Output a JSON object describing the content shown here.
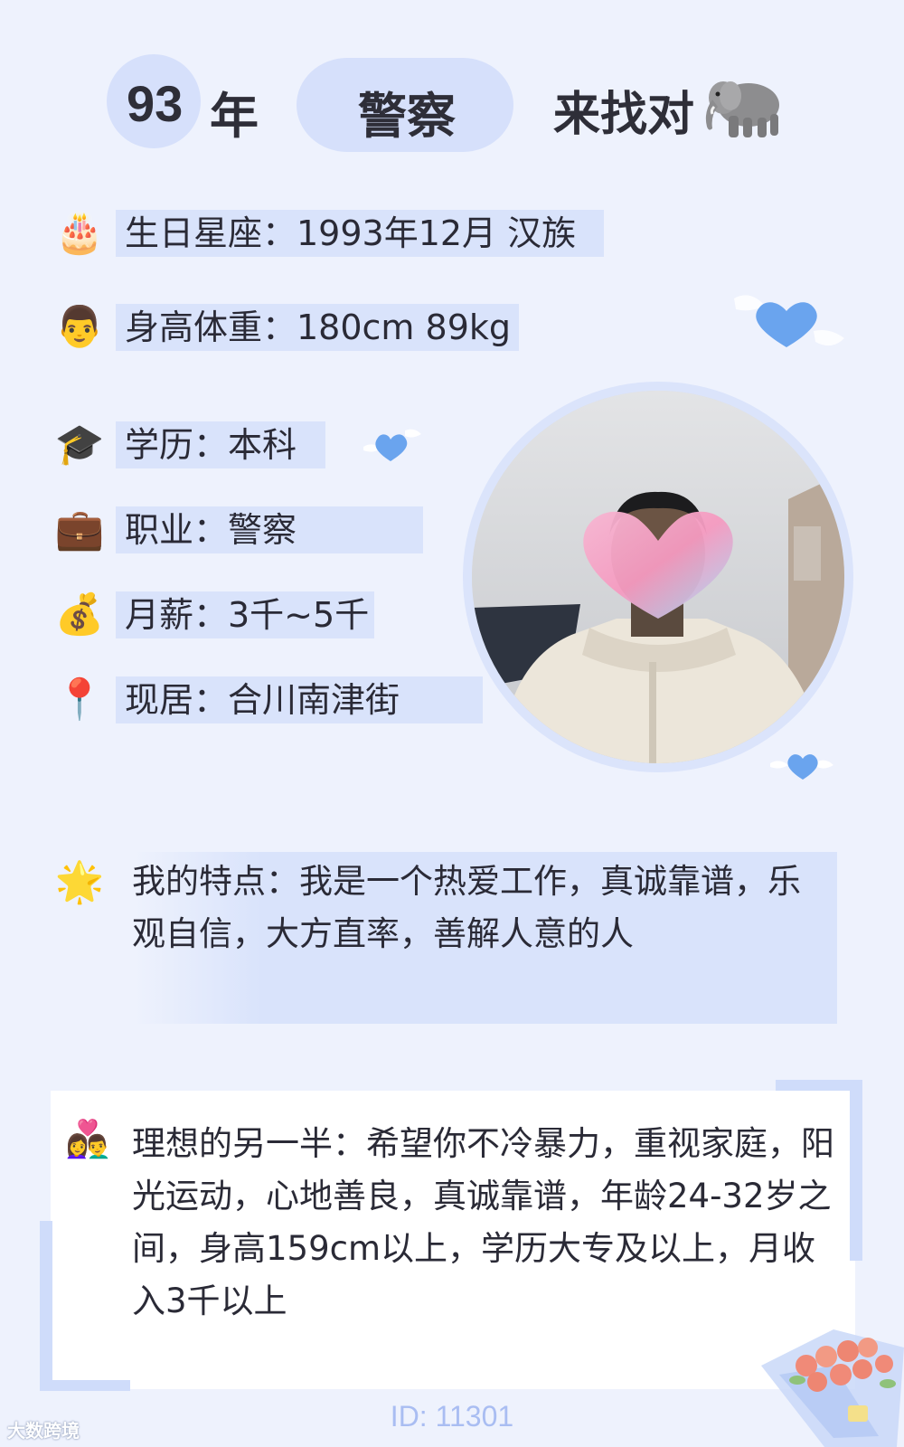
{
  "header": {
    "year": "93",
    "year_unit": "年",
    "job": "警察",
    "seeking": "来找对",
    "seeking_icon": "elephant-icon"
  },
  "info": [
    {
      "icon": "cake-icon",
      "glyph": "🎂",
      "label": "生日星座：1993年12月 汉族"
    },
    {
      "icon": "man-face-icon",
      "glyph": "👨",
      "label": "身高体重：180cm 89kg"
    },
    {
      "icon": "graduation-cap-icon",
      "glyph": "🎓",
      "label": "学历：本科"
    },
    {
      "icon": "briefcase-icon",
      "glyph": "💼",
      "label": "职业：警察"
    },
    {
      "icon": "money-bag-icon",
      "glyph": "💰",
      "label": "月薪：3千~5千"
    },
    {
      "icon": "location-pin-icon",
      "glyph": "📍",
      "label": "现居：合川南津街"
    }
  ],
  "features": {
    "icon": "star-icon",
    "glyph": "🌟",
    "text": "我的特点：我是一个热爱工作，真诚靠谱，乐观自信，大方直率，善解人意的人"
  },
  "ideal": {
    "icon": "couple-heart-icon",
    "glyph": "👩‍❤️‍👨",
    "text": "理想的另一半：希望你不冷暴力，重视家庭，阳光运动，心地善良，真诚靠谱，年龄24-32岁之间，身高159cm以上，学历大专及以上，月收入3千以上"
  },
  "id_label": "ID: 11301",
  "watermark": "大数跨境",
  "colors": {
    "background": "#eef2fd",
    "highlight": "#d9e3fb",
    "heart": "#6aa4ee",
    "id_text": "#a9bdf2"
  }
}
